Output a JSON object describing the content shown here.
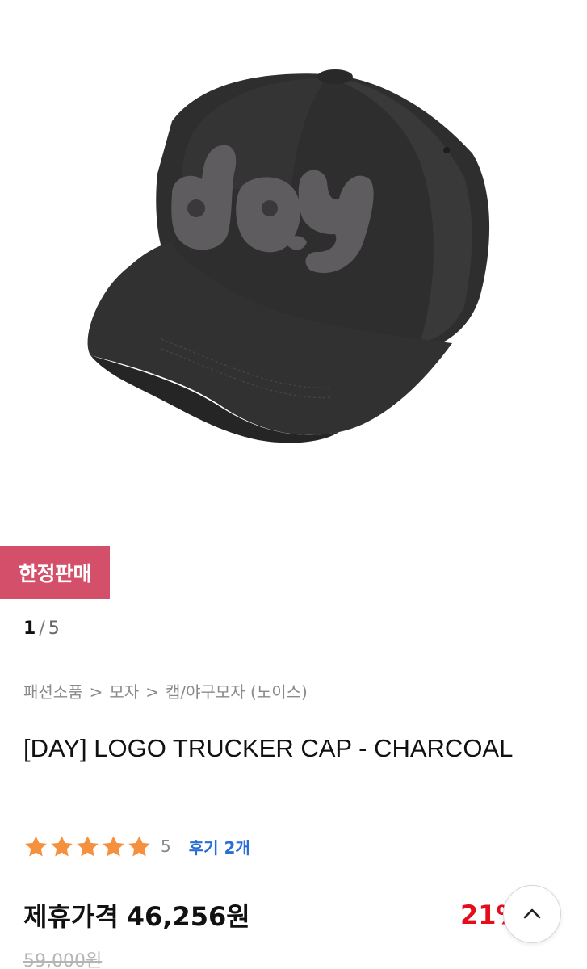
{
  "product": {
    "image_alt": "Charcoal baseball cap with day logo",
    "badge": "한정판매",
    "pager": {
      "current": "1",
      "separator": "/",
      "total": "5"
    },
    "breadcrumb": [
      "패션소품",
      "모자",
      "캡/야구모자 (노이스)"
    ],
    "breadcrumb_separator": ">",
    "title": "[DAY] LOGO TRUCKER CAP - CHARCOAL",
    "rating": {
      "stars": 5,
      "value": "5",
      "reviews_label": "후기 2개",
      "star_color": "#f5913e"
    },
    "price": {
      "label": "제휴가격",
      "amount": "46,256원",
      "discount": "21%",
      "original": "59,000원"
    }
  },
  "colors": {
    "badge": "#d4506a",
    "discount": "#e30d1b",
    "link": "#2b6fd6"
  },
  "icons": {
    "scroll_top": "chevron-up-icon",
    "star": "star-icon"
  }
}
